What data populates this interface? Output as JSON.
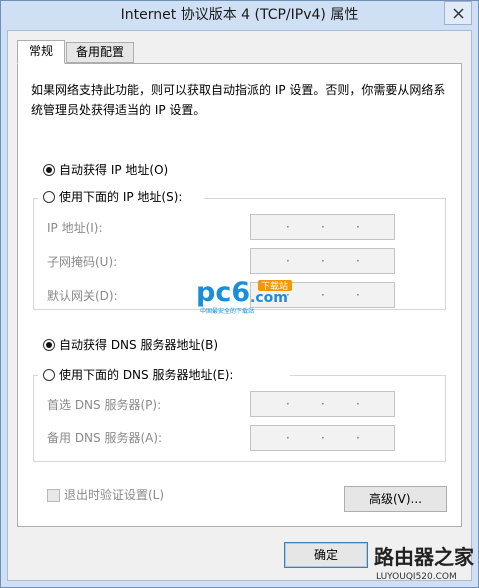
{
  "window": {
    "title": "Internet 协议版本 4 (TCP/IPv4) 属性"
  },
  "tabs": {
    "general": "常规",
    "alternate": "备用配置"
  },
  "description": "如果网络支持此功能，则可以获取自动指派的 IP 设置。否则，你需要从网络系统管理员处获得适当的 IP 设置。",
  "ip": {
    "auto_label": "自动获得 IP 地址(O)",
    "manual_label": "使用下面的 IP 地址(S):",
    "fields": [
      {
        "label": "IP 地址(I):",
        "dots": [
          "·",
          "·",
          "·"
        ]
      },
      {
        "label": "子网掩码(U):",
        "dots": [
          "·",
          "·",
          "·"
        ]
      },
      {
        "label": "默认网关(D):",
        "dots": [
          "·",
          "·",
          "·"
        ]
      }
    ],
    "selected": "auto"
  },
  "dns": {
    "auto_label": "自动获得 DNS 服务器地址(B)",
    "manual_label": "使用下面的 DNS 服务器地址(E):",
    "fields": [
      {
        "label": "首选 DNS 服务器(P):",
        "dots": [
          "·",
          "·",
          "·"
        ]
      },
      {
        "label": "备用 DNS 服务器(A):",
        "dots": [
          "·",
          "·",
          "·"
        ]
      }
    ],
    "selected": "auto"
  },
  "validate_label": "退出时验证设置(L)",
  "validate_checked": false,
  "advanced_label": "高级(V)...",
  "ok_label": "确定",
  "watermarks": {
    "pc6": {
      "main": "pc6",
      "sub": ".com",
      "tag": "下载站",
      "slogan": "中国最安全的下载站"
    },
    "site": {
      "main": "路由器之家",
      "url": "LUYOUQI520.COM"
    }
  },
  "colors": {
    "window_frame": "#cfe0f5",
    "panel": "#ffffff",
    "disabled_text": "#8a8a8a",
    "pc6_blue": "#1a8fd8",
    "pc6_orange": "#f39800"
  }
}
